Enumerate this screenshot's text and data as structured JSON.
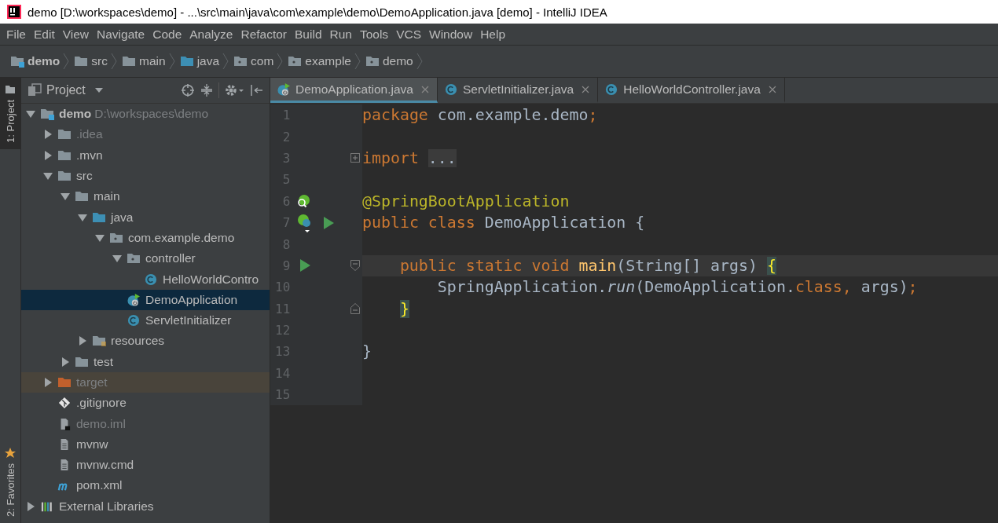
{
  "window": {
    "title": "demo [D:\\workspaces\\demo] - ...\\src\\main\\java\\com\\example\\demo\\DemoApplication.java [demo] - IntelliJ IDEA"
  },
  "menu": [
    "File",
    "Edit",
    "View",
    "Navigate",
    "Code",
    "Analyze",
    "Refactor",
    "Build",
    "Run",
    "Tools",
    "VCS",
    "Window",
    "Help"
  ],
  "breadcrumb": [
    {
      "label": "demo",
      "kind": "module"
    },
    {
      "label": "src",
      "kind": "folder"
    },
    {
      "label": "main",
      "kind": "folder"
    },
    {
      "label": "java",
      "kind": "source"
    },
    {
      "label": "com",
      "kind": "package"
    },
    {
      "label": "example",
      "kind": "package"
    },
    {
      "label": "demo",
      "kind": "package"
    }
  ],
  "tool_strip": {
    "top": {
      "label": "1: Project",
      "selected": true
    },
    "bottom": {
      "label": "2: Favorites",
      "selected": false
    }
  },
  "project_panel": {
    "title": "Project",
    "tree": [
      {
        "label": "demo",
        "path": "D:\\workspaces\\demo",
        "kind": "module",
        "expanded": true,
        "selected": false,
        "children": [
          {
            "label": ".idea",
            "kind": "folder",
            "expanded": false,
            "dimmed": true,
            "selected": false
          },
          {
            "label": ".mvn",
            "kind": "folder",
            "expanded": false,
            "selected": false
          },
          {
            "label": "src",
            "kind": "folder",
            "expanded": true,
            "selected": false,
            "children": [
              {
                "label": "main",
                "kind": "folder",
                "expanded": true,
                "selected": false,
                "children": [
                  {
                    "label": "java",
                    "kind": "source",
                    "expanded": true,
                    "selected": false,
                    "children": [
                      {
                        "label": "com.example.demo",
                        "kind": "package",
                        "expanded": true,
                        "selected": false,
                        "children": [
                          {
                            "label": "controller",
                            "kind": "package",
                            "expanded": true,
                            "selected": false,
                            "children": [
                              {
                                "label": "HelloWorldContro",
                                "kind": "class",
                                "selected": false
                              }
                            ]
                          },
                          {
                            "label": "DemoApplication",
                            "kind": "spring",
                            "selected": true
                          },
                          {
                            "label": "ServletInitializer",
                            "kind": "class",
                            "selected": false
                          }
                        ]
                      }
                    ]
                  },
                  {
                    "label": "resources",
                    "kind": "resources",
                    "expanded": false,
                    "selected": false
                  }
                ]
              },
              {
                "label": "test",
                "kind": "folder",
                "expanded": false,
                "selected": false
              }
            ]
          },
          {
            "label": "target",
            "kind": "excluded",
            "expanded": false,
            "dimmed": true,
            "selected": false
          },
          {
            "label": ".gitignore",
            "kind": "git",
            "selected": false
          },
          {
            "label": "demo.iml",
            "kind": "iml",
            "dimmed": true,
            "selected": false
          },
          {
            "label": "mvnw",
            "kind": "file",
            "selected": false
          },
          {
            "label": "mvnw.cmd",
            "kind": "file",
            "selected": false
          },
          {
            "label": "pom.xml",
            "kind": "maven",
            "selected": false
          }
        ]
      },
      {
        "label": "External Libraries",
        "kind": "libraries",
        "expanded": false,
        "selected": false
      }
    ]
  },
  "editor": {
    "tabs": [
      {
        "label": "DemoApplication.java",
        "kind": "spring",
        "selected": true
      },
      {
        "label": "ServletInitializer.java",
        "kind": "class",
        "selected": false
      },
      {
        "label": "HelloWorldController.java",
        "kind": "class",
        "selected": false
      }
    ],
    "lines": [
      {
        "number": "1",
        "tokens": [
          {
            "text": "package",
            "kind": "keyword"
          },
          {
            "text": " com.example.demo",
            "kind": "plain"
          },
          {
            "text": ";",
            "kind": "keyword"
          }
        ]
      },
      {
        "number": "2"
      },
      {
        "number": "3",
        "fold": {
          "kind": "collapsed"
        },
        "tokens": [
          {
            "text": "import",
            "kind": "keyword"
          },
          {
            "text": "...",
            "kind": "folded"
          }
        ]
      },
      {
        "number": "5"
      },
      {
        "number": "6",
        "markers": [
          {
            "kind": "bean"
          }
        ],
        "tokens": [
          {
            "text": "@SpringBootApplication",
            "kind": "annotation"
          }
        ]
      },
      {
        "number": "7",
        "markers": [
          {
            "kind": "spring-class"
          },
          {
            "kind": "run"
          }
        ],
        "tokens": [
          {
            "text": "public class",
            "kind": "keyword"
          },
          {
            "text": " DemoApplication {",
            "kind": "plain"
          }
        ],
        "children": [
          {
            "number": "8"
          },
          {
            "number": "9",
            "current": true,
            "fold": {
              "kind": "start"
            },
            "markers": [
              {
                "kind": "run"
              }
            ],
            "tokens": [
              {
                "text": "public static void",
                "kind": "keyword"
              },
              {
                "text": " main",
                "kind": "method"
              },
              {
                "text": "(String[] args) ",
                "kind": "plain"
              },
              {
                "text": "{",
                "kind": "brace"
              }
            ],
            "children": [
              {
                "number": "10",
                "tokens": [
                  {
                    "text": "SpringApplication.",
                    "kind": "plain"
                  },
                  {
                    "text": "run",
                    "kind": "static"
                  },
                  {
                    "text": "(DemoApplication.",
                    "kind": "plain"
                  },
                  {
                    "text": "class",
                    "kind": "keyword"
                  },
                  {
                    "text": ",",
                    "kind": "keyword"
                  },
                  {
                    "text": " args)",
                    "kind": "plain"
                  },
                  {
                    "text": ";",
                    "kind": "keyword"
                  }
                ]
              }
            ]
          },
          {
            "number": "11",
            "fold": {
              "kind": "end"
            },
            "tokens": [
              {
                "text": "}",
                "kind": "brace"
              }
            ]
          },
          {
            "number": "12"
          }
        ]
      },
      {
        "number": "13",
        "tokens": [
          {
            "text": "}",
            "kind": "plain"
          }
        ]
      },
      {
        "number": "14"
      },
      {
        "number": "15"
      }
    ]
  }
}
